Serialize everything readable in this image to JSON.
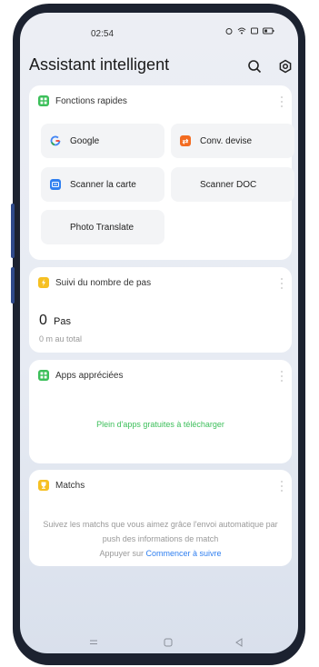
{
  "status_bar": {
    "time": "02:54"
  },
  "header": {
    "title": "Assistant intelligent",
    "search_icon": "search-icon",
    "settings_icon": "gear-icon"
  },
  "quick_functions": {
    "title": "Fonctions rapides",
    "color": "#3cbf5a",
    "tiles": [
      {
        "label": "Google",
        "icon": "google-icon"
      },
      {
        "label": "Conv. devise",
        "icon": "currency-convert-icon",
        "color": "#f36c21"
      },
      {
        "label": "Scanner la carte",
        "icon": "card-scan-icon",
        "color": "#2f7ff0"
      },
      {
        "label": "Scanner DOC",
        "icon": "doc-scan-icon"
      },
      {
        "label": "Photo Translate",
        "icon": "photo-translate-icon"
      }
    ]
  },
  "steps": {
    "title": "Suivi du nombre de pas",
    "color": "#f6c022",
    "count": "0",
    "unit": "Pas",
    "total": "0 m au total"
  },
  "apps": {
    "title": "Apps appréciées",
    "color": "#3cbf5a",
    "message": "Plein d'apps gratuites à télécharger"
  },
  "matches": {
    "title": "Matchs",
    "color": "#f6c022",
    "description": "Suivez les matchs que vous aimez grâce l'envoi automatique par push des informations de match",
    "prompt": "Appuyer sur",
    "link": "Commencer à suivre"
  },
  "navigation": {
    "menu_icon": "menu-icon",
    "home_icon": "home-icon",
    "back_icon": "back-icon"
  }
}
